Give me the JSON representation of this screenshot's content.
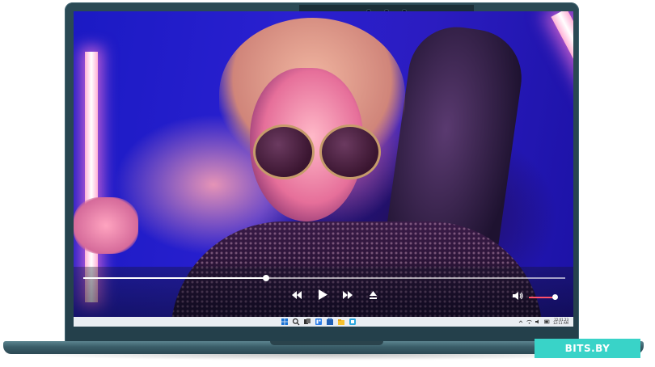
{
  "player": {
    "progress_fraction": 0.38,
    "volume_fraction": 0.93,
    "buttons": {
      "rewind_icon": "rewind-icon",
      "play_icon": "play-icon",
      "fast_forward_icon": "fast-forward-icon",
      "eject_icon": "eject-icon",
      "volume_icon": "speaker-icon"
    }
  },
  "taskbar": {
    "icons": [
      "windows-start-icon",
      "search-icon",
      "task-view-icon",
      "widgets-icon",
      "store-icon",
      "file-explorer-icon",
      "app-icon"
    ],
    "clock_time": "22.01.23",
    "clock_date": "12:11 AM"
  },
  "watermark": {
    "text": "BITS.BY"
  },
  "colors": {
    "accent_volume": "#ff4f6a",
    "watermark_bg": "#39d3c8",
    "lid": "#2b4a55"
  }
}
